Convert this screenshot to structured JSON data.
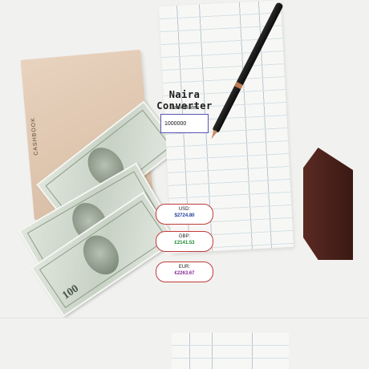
{
  "app": {
    "title": "Naira Converter",
    "rates_label": "Bank Rates"
  },
  "input": {
    "amount_value": "1000000"
  },
  "results": [
    {
      "currency": "USD:",
      "value": "$2724.80",
      "color": "#1f3f9a"
    },
    {
      "currency": "GBP:",
      "value": "£2141.53",
      "color": "#1d8a35"
    },
    {
      "currency": "EUR:",
      "value": "€2263.67",
      "color": "#8a2b9a"
    }
  ],
  "background": {
    "cashbook_label": "CASHBOOK"
  }
}
